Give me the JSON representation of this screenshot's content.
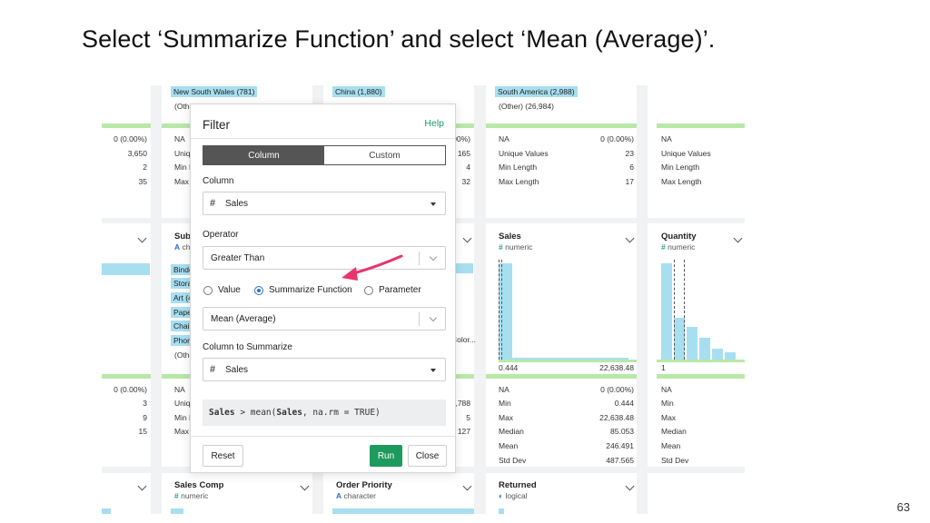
{
  "slide": {
    "title": "Select ‘Summarize Function’ and select ‘Mean (Average)’.",
    "page_number": "63"
  },
  "background": {
    "top_labels": [
      "New South Wales (781)",
      "China (1,880)",
      "South America (2,988)"
    ],
    "top_labels_other": [
      "(Othe",
      "(Other) (26,984)"
    ],
    "col0_rows": [
      "0 (0.00%)",
      "3,650",
      "2",
      "35"
    ],
    "col1_rows": [
      "NA",
      "Uniqu",
      "Min L",
      "Max L"
    ],
    "col2_rows_right": [
      "00%)",
      "165",
      "4",
      "32"
    ],
    "col3": {
      "labels": [
        "NA",
        "Unique Values",
        "Min Length",
        "Max Length"
      ],
      "values": [
        "0 (0.00%)",
        "23",
        "6",
        "17"
      ]
    },
    "col4_labels": [
      "NA",
      "Unique Values",
      "Min Length",
      "Max Length"
    ],
    "card_subcat": {
      "title": "Sub-",
      "type": "ch"
    },
    "subcat_items": [
      "Binde",
      "Stora",
      "Art (4",
      "Pape",
      "Chair",
      "Phon"
    ],
    "subcat_other": "(Othe",
    "col2_mid_text": "Color...",
    "sales_card": {
      "title": "Sales",
      "type": "numeric",
      "range_min": "0.444",
      "range_max": "22,638.48"
    },
    "quantity_card": {
      "title": "Quantity",
      "type": "numeric",
      "range_min": "1"
    },
    "col0_bottom_rows": [
      "0 (0.00%)",
      "3",
      "9",
      "15"
    ],
    "col1_bottom_rows": [
      "NA",
      "Uniqu",
      "Min L",
      "Max L"
    ],
    "col2_bottom_rows_right": [
      ",788",
      "5",
      "127"
    ],
    "sales_stats": {
      "labels": [
        "NA",
        "Min",
        "Max",
        "Median",
        "Mean",
        "Std Dev"
      ],
      "values": [
        "0 (0.00%)",
        "0.444",
        "22,638.48",
        "85.053",
        "246.491",
        "487.565"
      ]
    },
    "quantity_stats": [
      "NA",
      "Min",
      "Max",
      "Median",
      "Mean",
      "Std Dev"
    ],
    "bottom_cards": [
      {
        "title": "Sales Comp",
        "type": "numeric",
        "icon": "hash-icon"
      },
      {
        "title": "Order Priority",
        "type": "character",
        "icon": "text-icon"
      },
      {
        "title": "Returned",
        "type": "logical",
        "icon": "toggle-icon"
      }
    ]
  },
  "filter_dialog": {
    "title": "Filter",
    "help": "Help",
    "tabs": [
      "Column",
      "Custom"
    ],
    "active_tab": "Column",
    "column_label": "Column",
    "column_value": "Sales",
    "operator_label": "Operator",
    "operator_value": "Greater Than",
    "radio_options": [
      "Value",
      "Summarize Function",
      "Parameter"
    ],
    "selected_radio": "Summarize Function",
    "function_value": "Mean (Average)",
    "summarize_label": "Column to Summarize",
    "summarize_value": "Sales",
    "code_parts": [
      "Sales",
      " > mean(",
      "Sales",
      ", na.rm = TRUE)"
    ],
    "buttons": {
      "reset": "Reset",
      "run": "Run",
      "close": "Close"
    }
  },
  "colors": {
    "accent_green": "#1f9a5e",
    "radio_blue": "#2b6fd6",
    "annotation_arrow": "#e8356b",
    "histogram": "#a7dff0"
  }
}
